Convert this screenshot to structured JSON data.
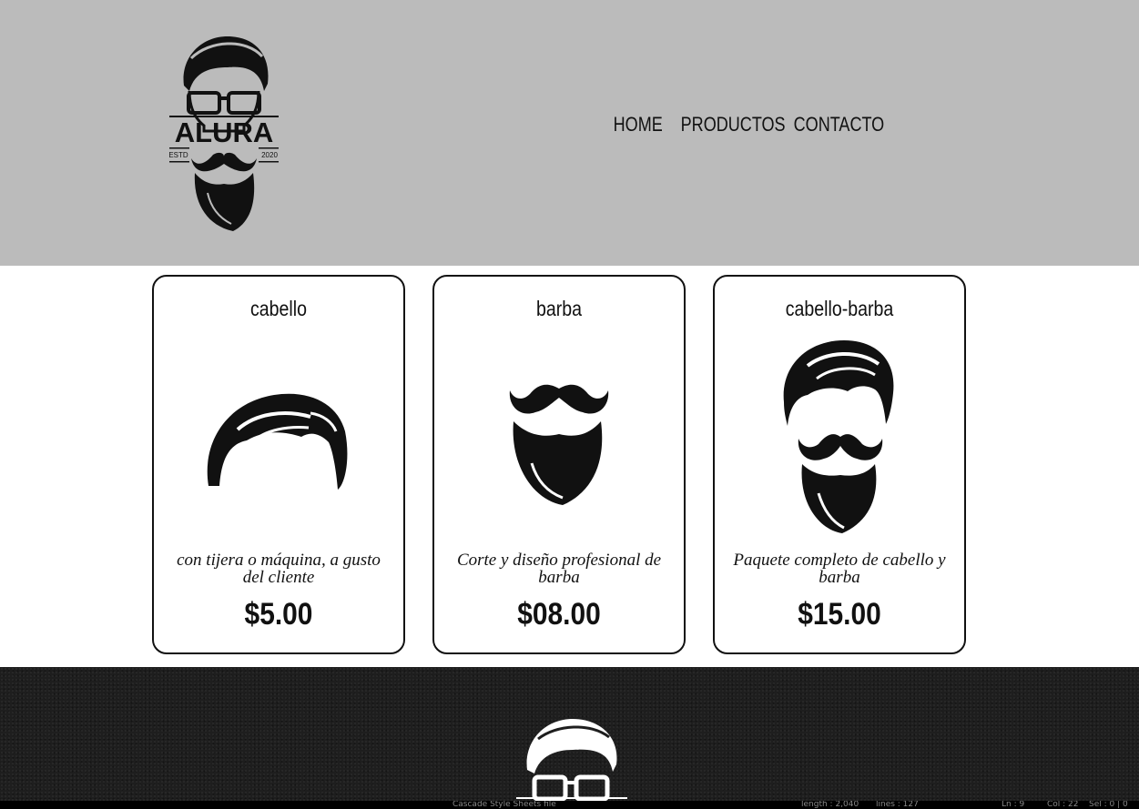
{
  "header": {
    "logo": {
      "brand": "ALURA",
      "left_text": "ESTD",
      "right_text": "2020"
    },
    "nav": [
      {
        "label": "HOME"
      },
      {
        "label": "PRODUCTOS"
      },
      {
        "label": "CONTACTO"
      }
    ]
  },
  "products": [
    {
      "title": "cabello",
      "description": "con tijera o máquina, a gusto del cliente",
      "price": "$5.00",
      "image": "hair-icon"
    },
    {
      "title": "barba",
      "description": "Corte y diseño profesional de barba",
      "price": "$08.00",
      "image": "beard-icon"
    },
    {
      "title": "cabello-barba",
      "description": "Paquete completo de cabello y barba",
      "price": "$15.00",
      "image": "hair-and-beard-icon"
    }
  ],
  "statusbar": {
    "file_type": "Cascade Style Sheets file",
    "length": "length : 2,040",
    "lines": "lines : 127",
    "position": "Ln : 9",
    "col": "Col : 22",
    "sel": "Sel : 0 | 0"
  }
}
